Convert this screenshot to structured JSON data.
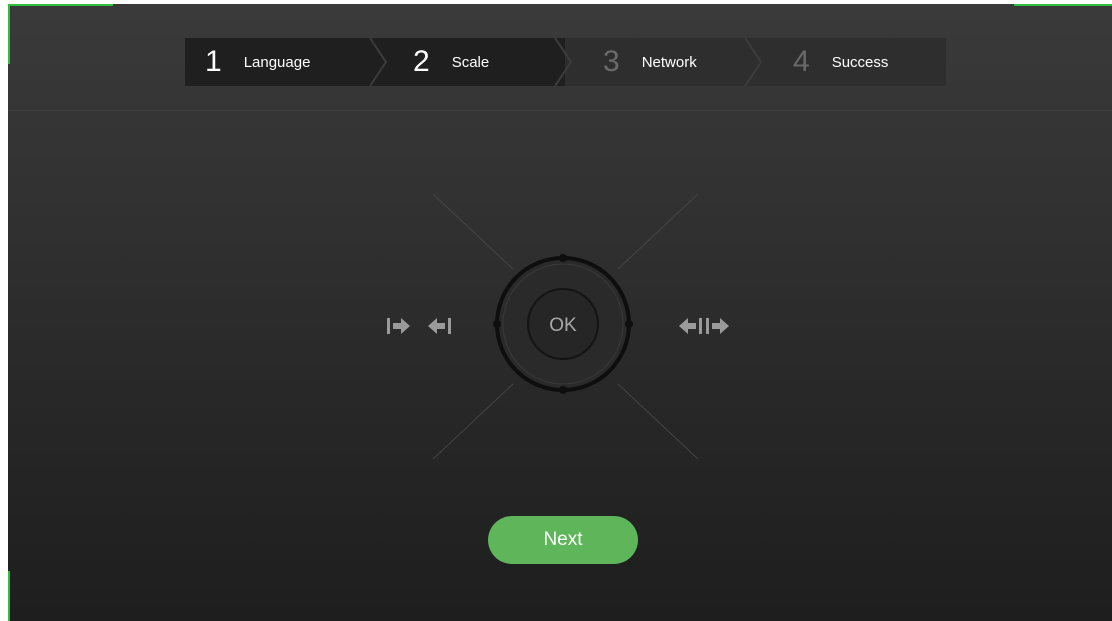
{
  "steps": [
    {
      "number": "1",
      "label": "Language",
      "state": "done"
    },
    {
      "number": "2",
      "label": "Scale",
      "state": "active"
    },
    {
      "number": "3",
      "label": "Network",
      "state": "pending"
    },
    {
      "number": "4",
      "label": "Success",
      "state": "pending"
    }
  ],
  "dpad": {
    "center_label": "OK",
    "left_icon": "shrink-arrows-icon",
    "right_icon": "expand-arrows-icon"
  },
  "actions": {
    "next_label": "Next"
  },
  "colors": {
    "accent": "#5eb55a",
    "corner_marker": "#2fbf3f",
    "background": "#2b2b2b"
  }
}
